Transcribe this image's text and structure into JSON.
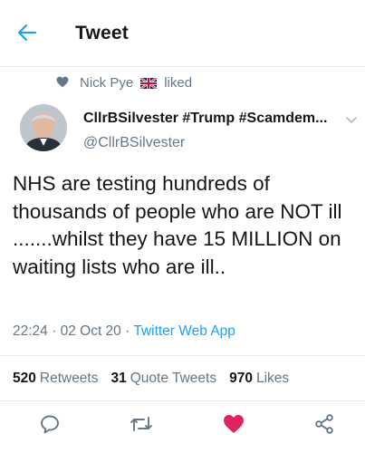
{
  "header": {
    "title": "Tweet",
    "back_icon": "arrow-left-icon"
  },
  "social_context": {
    "user": "Nick Pye",
    "flag_icon": "uk-flag-icon",
    "action": "liked",
    "icon": "heart-icon"
  },
  "author": {
    "display_name": "CllrBSilvester #Trump #Scamdem...",
    "handle": "@CllrBSilvester"
  },
  "tweet": {
    "text": "NHS are testing hundreds of thousands of people who are NOT ill .......whilst they have 15 MILLION on waiting lists who are ill..",
    "time": "22:24",
    "date": "02 Oct 20",
    "separator": "·",
    "source": "Twitter Web App"
  },
  "stats": {
    "retweets_count": "520",
    "retweets_label": "Retweets",
    "quotes_count": "31",
    "quotes_label": "Quote Tweets",
    "likes_count": "970",
    "likes_label": "Likes"
  },
  "actions": [
    "reply-icon",
    "retweet-icon",
    "like-icon",
    "share-icon"
  ],
  "colors": {
    "accent": "#1da1f2",
    "like": "#e0245e",
    "secondary_text": "#657786",
    "primary_text": "#14171a"
  }
}
